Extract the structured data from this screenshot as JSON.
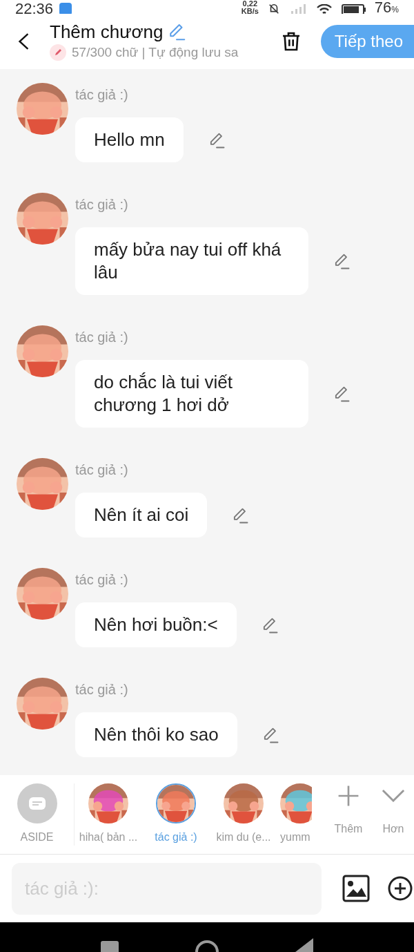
{
  "status_bar": {
    "time": "22:36",
    "speed": "0,22",
    "speed_unit": "KB/s",
    "battery": "76",
    "battery_unit": "%"
  },
  "header": {
    "title": "Thêm chương",
    "subtitle": "57/300 chữ | Tự động lưu sa",
    "next_button": "Tiếp theo"
  },
  "messages": [
    {
      "author": "tác giả :)",
      "text": "Hello mn"
    },
    {
      "author": "tác giả :)",
      "text": "mấy bửa nay tui off khá lâu"
    },
    {
      "author": "tác giả :)",
      "text": "do chắc là tui viết chương 1 hơi dở"
    },
    {
      "author": "tác giả :)",
      "text": "Nên ít ai coi"
    },
    {
      "author": "tác giả :)",
      "text": "Nên hơi buồn:<"
    },
    {
      "author": "tác giả :)",
      "text": "Nên thôi ko sao"
    }
  ],
  "characters": [
    {
      "kind": "aside",
      "name": "ASIDE",
      "selected": false
    },
    {
      "kind": "avatar",
      "name": "hiha( bản ...",
      "selected": false
    },
    {
      "kind": "avatar",
      "name": "tác giả :)",
      "selected": true
    },
    {
      "kind": "avatar",
      "name": "kim du (e...",
      "selected": false
    },
    {
      "kind": "avatar",
      "name": "yumm",
      "selected": false
    },
    {
      "kind": "add",
      "name": "Thêm",
      "selected": false
    },
    {
      "kind": "more",
      "name": "Hơn",
      "selected": false
    }
  ],
  "composer": {
    "placeholder": "tác giả :):"
  }
}
